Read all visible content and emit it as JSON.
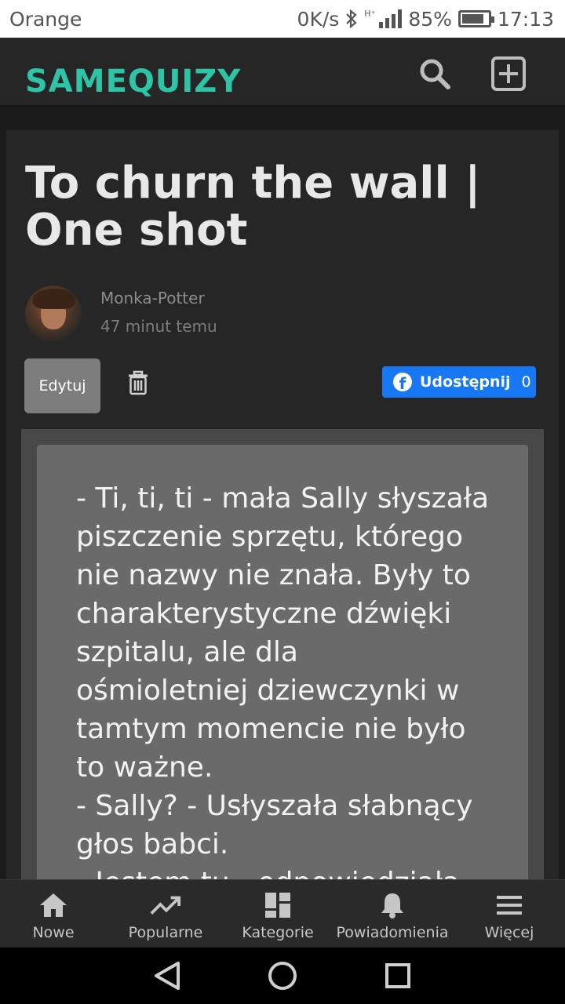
{
  "status_bar": {
    "carrier": "Orange",
    "net_speed": "0K/s",
    "battery": "85%",
    "battery_level": 0.85,
    "time": "17:13"
  },
  "header": {
    "logo_same": "SAME",
    "logo_quizy": "QUIZY",
    "brand_color": "#2ec4a6",
    "icons": [
      "search-icon",
      "add-box-icon"
    ]
  },
  "post": {
    "title": "To churn the wall | One shot",
    "author": "Monka-Potter",
    "time": "47 minut temu",
    "edit_label": "Edytuj",
    "share_label": "Udostępnij",
    "share_count": "0",
    "share_color": "#1877f2",
    "story": "- Ti, ti, ti - mała Sally słyszała\npiszczenie sprzętu, którego\nnie nazwy nie znała. Były to\ncharakterystyczne dźwięki\nszpitalu, ale dla\nośmioletniej dziewczynki w\ntamtym momencie nie było\nto ważne.\n- Sally? - Usłyszała słabnący\ngłos babci.\n- Jestem tu - odpowiedziała"
  },
  "bottom_nav": {
    "items": [
      {
        "label": "Nowe",
        "icon": "home-icon"
      },
      {
        "label": "Popularne",
        "icon": "trending-icon"
      },
      {
        "label": "Kategorie",
        "icon": "categories-icon"
      },
      {
        "label": "Powiadomienia",
        "icon": "bell-icon"
      },
      {
        "label": "Więcej",
        "icon": "menu-icon"
      }
    ]
  }
}
